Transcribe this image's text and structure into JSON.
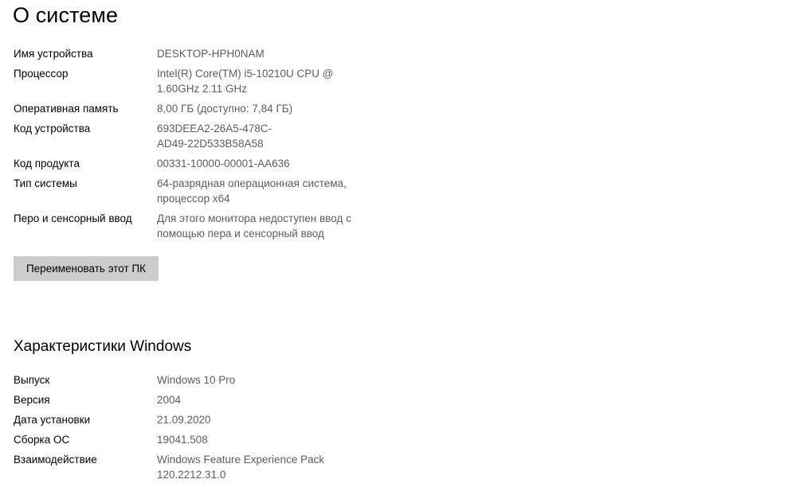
{
  "page": {
    "title": "О системе"
  },
  "device_specs": [
    {
      "label": "Имя устройства",
      "value": "DESKTOP-HPH0NAM"
    },
    {
      "label": "Процессор",
      "value": "Intel(R) Core(TM) i5-10210U CPU @\n1.60GHz   2.11 GHz"
    },
    {
      "label": "Оперативная память",
      "value": "8,00 ГБ (доступно: 7,84 ГБ)"
    },
    {
      "label": "Код устройства",
      "value": "693DEEA2-26A5-478C-\nAD49-22D533B58A58"
    },
    {
      "label": "Код продукта",
      "value": "00331-10000-00001-AA636"
    },
    {
      "label": "Тип системы",
      "value": "64-разрядная операционная система,\nпроцессор x64"
    },
    {
      "label": "Перо и сенсорный ввод",
      "value": "Для этого монитора недоступен ввод с\nпомощью пера и сенсорный ввод"
    }
  ],
  "rename_button": {
    "label": "Переименовать этот ПК"
  },
  "windows_section": {
    "heading": "Характеристики Windows",
    "specs": [
      {
        "label": "Выпуск",
        "value": "Windows 10 Pro"
      },
      {
        "label": "Версия",
        "value": "2004"
      },
      {
        "label": "Дата установки",
        "value": "21.09.2020"
      },
      {
        "label": "Сборка ОС",
        "value": "19041.508"
      },
      {
        "label": "Взаимодействие",
        "value": "Windows Feature Experience Pack\n120.2212.31.0"
      }
    ]
  },
  "colors": {
    "label_text": "#000000",
    "value_text": "#5c5c5c",
    "button_background": "#cccccc",
    "page_background": "#ffffff"
  }
}
